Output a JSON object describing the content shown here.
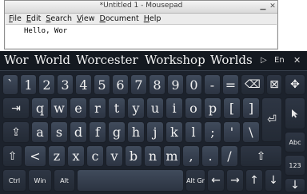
{
  "window": {
    "title": "*Untitled 1 - Mousepad",
    "menu": [
      "File",
      "Edit",
      "Search",
      "View",
      "Document",
      "Help"
    ],
    "content": "Hello, Wor",
    "icons": {
      "minimize": "minimize-icon",
      "close": "close-icon"
    }
  },
  "keyboard": {
    "suggestions": [
      "Wor",
      "World",
      "Worcester",
      "Workshop",
      "Worlds"
    ],
    "language": "En",
    "rows": {
      "r1": [
        "`",
        "1",
        "2",
        "3",
        "4",
        "5",
        "6",
        "7",
        "8",
        "9",
        "0",
        "-",
        "="
      ],
      "r2": [
        "q",
        "w",
        "e",
        "r",
        "t",
        "y",
        "u",
        "i",
        "o",
        "p",
        "[",
        "]"
      ],
      "r3": [
        "a",
        "s",
        "d",
        "f",
        "g",
        "h",
        "j",
        "k",
        "l",
        ";",
        "'",
        "\\"
      ],
      "r4": [
        "<",
        "z",
        "x",
        "c",
        "v",
        "b",
        "n",
        "m",
        ",",
        ".",
        "/"
      ]
    },
    "labels": {
      "ctrl": "Ctrl",
      "win": "Win",
      "alt": "Alt",
      "altgr": "Alt Gr",
      "abc": "Abc",
      "num": "123"
    },
    "glyphs": {
      "backspace": "⌫",
      "close": "⊠",
      "move": "✥",
      "tab": "⇥",
      "caps": "⇪",
      "enter": "⏎",
      "shift": "⇧",
      "shift_right": "⇧",
      "left": "←",
      "right": "→",
      "up": "↑",
      "down": "↓",
      "sugg_arrow": "▷",
      "sugg_close": "✕"
    },
    "colors": {
      "background": "#1c222c",
      "key": "#36404f",
      "text": "#f0f0f0"
    }
  }
}
